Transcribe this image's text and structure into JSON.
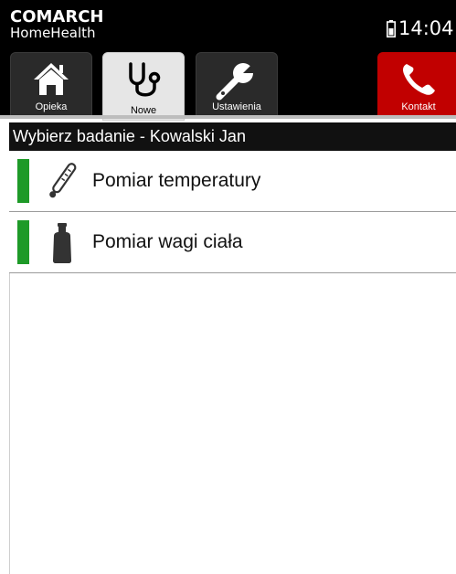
{
  "status_bar": {
    "brand_main": "COMARCH",
    "brand_sub": "HomeHealth",
    "clock": "14:04",
    "battery_icon": "battery-icon"
  },
  "tabs": [
    {
      "label": "Opieka",
      "icon": "home-icon",
      "active": false
    },
    {
      "label": "Nowe",
      "icon": "stethoscope-icon",
      "active": true
    },
    {
      "label": "Ustawienia",
      "icon": "wrench-icon",
      "active": false
    },
    {
      "label": "Kontakt",
      "icon": "phone-icon",
      "active": false
    }
  ],
  "colors": {
    "kontakt_tab": "#c10000",
    "status_ok": "#1e9a28",
    "active_tab": "#e6e6e6"
  },
  "screen_title": "Wybierz badanie - Kowalski Jan",
  "measurements": [
    {
      "label": "Pomiar temperatury",
      "icon": "thermometer-icon"
    },
    {
      "label": "Pomiar wagi ciała",
      "icon": "weight-icon"
    }
  ]
}
